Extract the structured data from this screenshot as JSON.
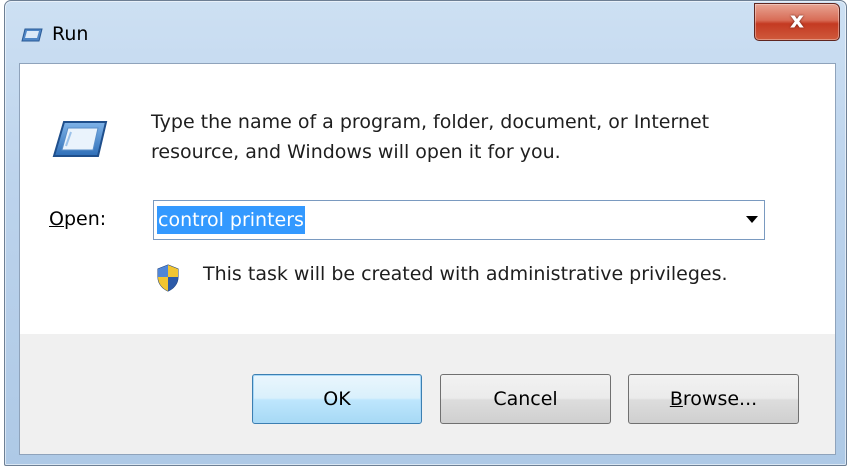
{
  "window": {
    "title": "Run",
    "close_glyph": "x"
  },
  "dialog": {
    "description": "Type the name of a program, folder, document, or Internet resource, and Windows will open it for you.",
    "open_label_mnemonic": "O",
    "open_label_rest": "pen:",
    "open_value": "control printers",
    "admin_note": "This task will be created with administrative privileges."
  },
  "buttons": {
    "ok": "OK",
    "cancel": "Cancel",
    "browse_mnemonic": "B",
    "browse_rest": "rowse..."
  },
  "icons": {
    "title": "run-icon",
    "main": "run-icon",
    "uac": "uac-shield-icon",
    "dropdown": "chevron-down-icon"
  },
  "colors": {
    "selection": "#3399ff",
    "close_button": "#c43a22",
    "default_button_border": "#3c7fb1"
  }
}
